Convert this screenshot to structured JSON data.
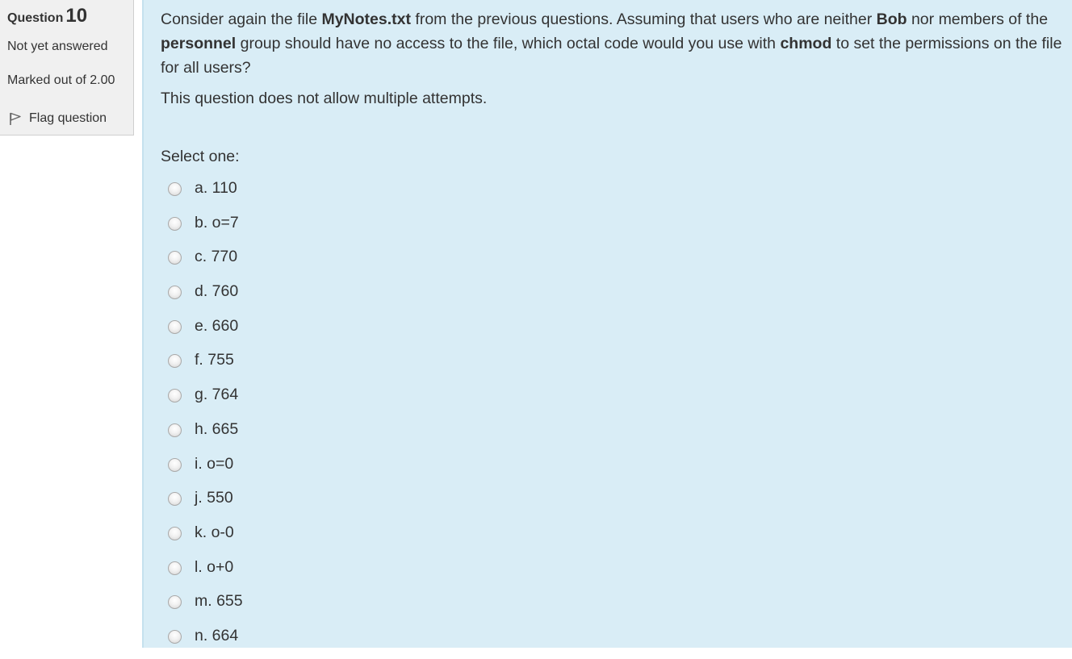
{
  "info": {
    "question_label": "Question",
    "question_number": "10",
    "state": "Not yet answered",
    "grade": "Marked out of 2.00",
    "flag_label": "Flag question"
  },
  "question": {
    "text_parts": [
      "Consider again the file ",
      "MyNotes.txt",
      " from the previous questions. Assuming that users who are neither ",
      "Bob",
      " nor members of the ",
      "personnel",
      " group should have no access to the file, which octal code would you use with ",
      "chmod",
      " to set the permissions on the file for all users?"
    ],
    "attempts_note": "This question does not allow multiple attempts.",
    "prompt": "Select one:"
  },
  "answers": [
    {
      "label": "a. 110"
    },
    {
      "label": "b. o=7"
    },
    {
      "label": "c. 770"
    },
    {
      "label": "d. 760"
    },
    {
      "label": "e. 660"
    },
    {
      "label": "f. 755"
    },
    {
      "label": "g. 764"
    },
    {
      "label": "h. 665"
    },
    {
      "label": "i. o=0"
    },
    {
      "label": "j. 550"
    },
    {
      "label": "k. o-0"
    },
    {
      "label": "l. o+0"
    },
    {
      "label": "m. 655"
    },
    {
      "label": "n. 664"
    }
  ],
  "colors": {
    "content_bg": "#d9edf6",
    "info_bg": "#f0f0f0",
    "text": "#333333"
  }
}
